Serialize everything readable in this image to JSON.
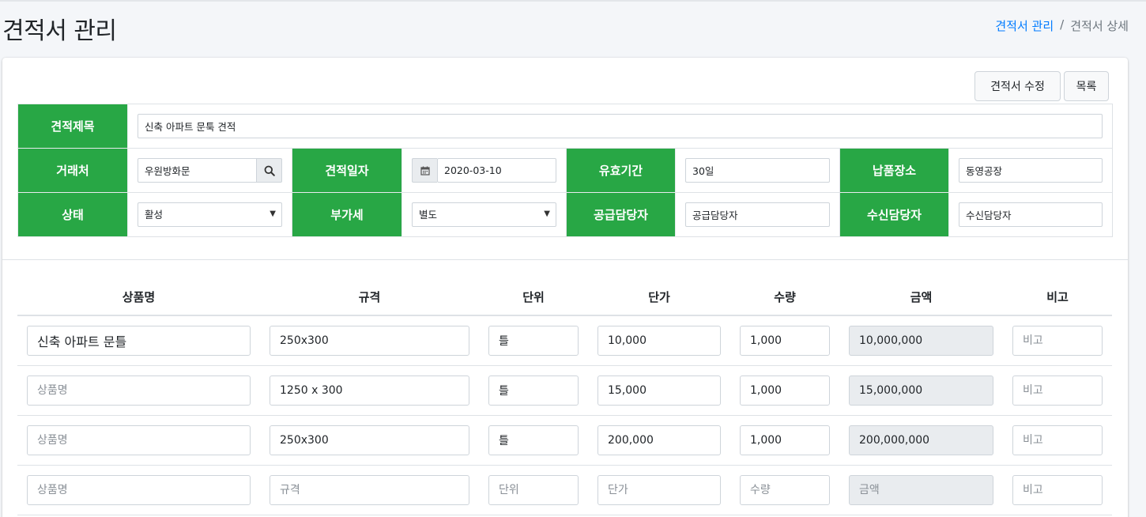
{
  "page": {
    "title": "견적서 관리"
  },
  "breadcrumb": {
    "items": [
      "견적서 관리",
      "견적서 상세"
    ],
    "separator": "/"
  },
  "toolbar": {
    "edit_label": "견적서 수정",
    "list_label": "목록"
  },
  "form": {
    "title_label": "견적제목",
    "title_value": "신축 아파트 문툭 견적",
    "client_label": "거래처",
    "client_value": "우원방화문",
    "date_label": "견적일자",
    "date_value": "2020-03-10",
    "validity_label": "유효기간",
    "validity_value": "30일",
    "delivery_label": "납품장소",
    "delivery_value": "동영공장",
    "status_label": "상태",
    "status_value": "활성",
    "vat_label": "부가세",
    "vat_value": "별도",
    "supplier_manager_label": "공급담당자",
    "supplier_manager_value": "공급담당자",
    "receiver_manager_label": "수신담당자",
    "receiver_manager_value": "수신담당자"
  },
  "items": {
    "headers": [
      "상품명",
      "규격",
      "단위",
      "단가",
      "수량",
      "금액",
      "비고"
    ],
    "placeholders": [
      "상품명",
      "규격",
      "단위",
      "단가",
      "수량",
      "금액",
      "비고"
    ],
    "rows": [
      [
        "신축 아파트 문틀",
        "250x300",
        "틀",
        "10,000",
        "1,000",
        "10,000,000",
        ""
      ],
      [
        "",
        "1250 x 300",
        "틀",
        "15,000",
        "1,000",
        "15,000,000",
        ""
      ],
      [
        "",
        "250x300",
        "틀",
        "200,000",
        "1,000",
        "200,000,000",
        ""
      ],
      [
        "",
        "",
        "",
        "",
        "",
        "",
        ""
      ]
    ]
  },
  "icons": {
    "search": "search-icon",
    "calendar": "calendar-icon",
    "dropdown": "chevron-down-icon"
  },
  "colors": {
    "label_bg": "#28a745",
    "link": "#007bff",
    "readonly_bg": "#e9ecef"
  }
}
